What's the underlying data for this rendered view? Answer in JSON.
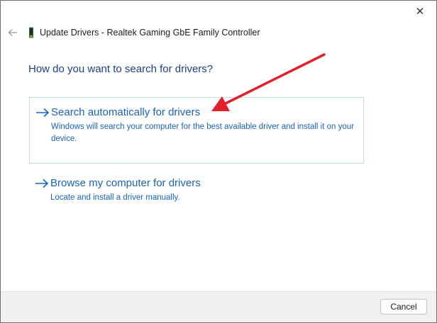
{
  "window": {
    "close_glyph": "✕",
    "title": "Update Drivers - Realtek Gaming GbE Family Controller"
  },
  "content": {
    "question": "How do you want to search for drivers?",
    "options": [
      {
        "title": "Search automatically for drivers",
        "description": "Windows will search your computer for the best available driver and install it on your device."
      },
      {
        "title": "Browse my computer for drivers",
        "description": "Locate and install a driver manually."
      }
    ]
  },
  "footer": {
    "cancel_label": "Cancel"
  },
  "icons": {
    "back": "back-arrow-icon",
    "device": "network-adapter-icon",
    "option_arrow": "right-arrow-icon",
    "close": "close-icon"
  },
  "colors": {
    "link_blue": "#1a63b8",
    "heading_blue": "#1c3f8a",
    "selected_border": "#c5dcee",
    "annotation_red": "#e0202a"
  }
}
